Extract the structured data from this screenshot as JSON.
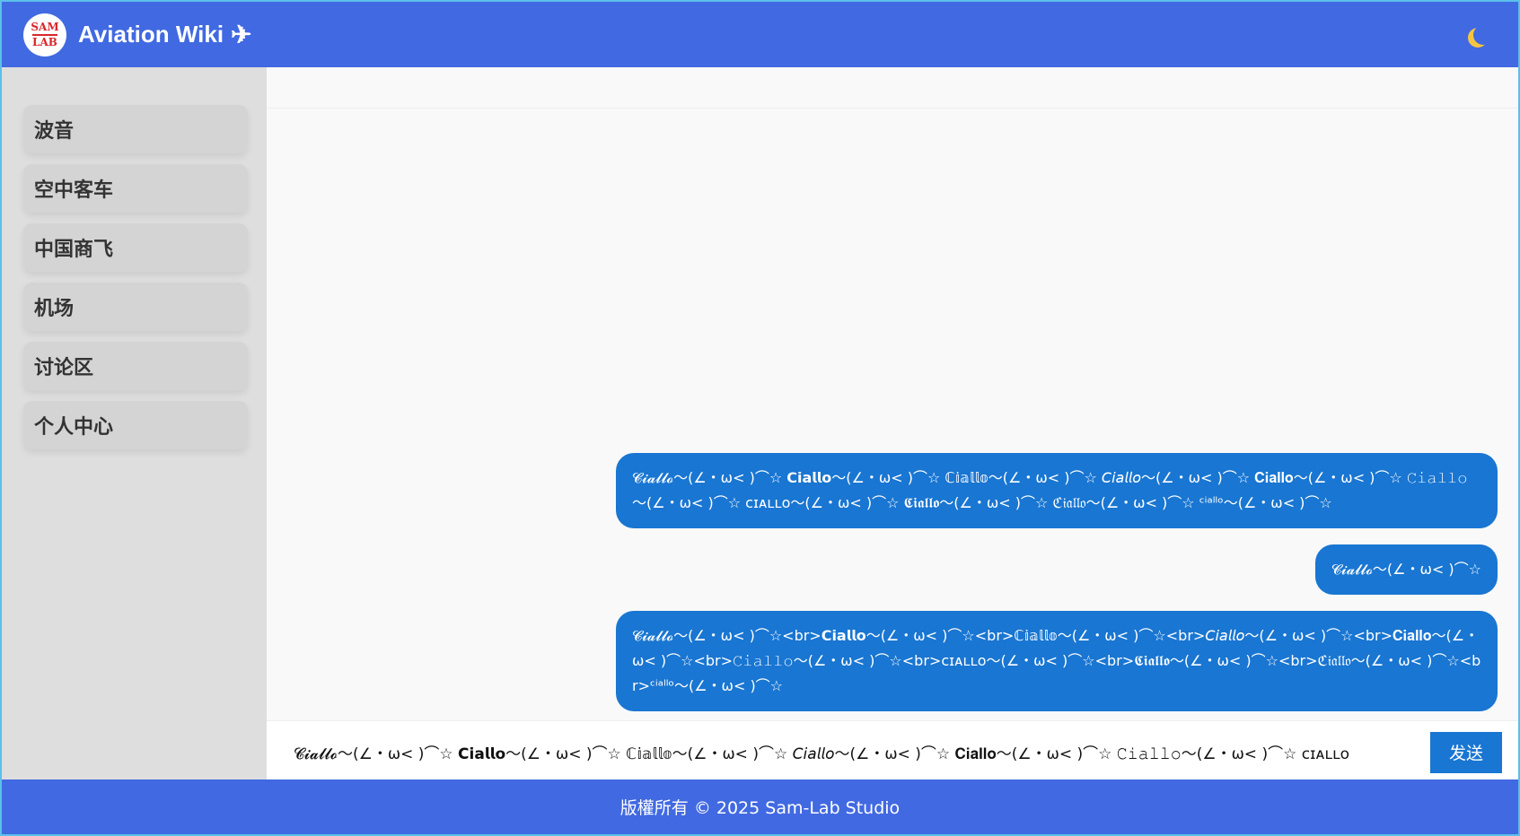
{
  "header": {
    "logo_top": "SAM",
    "logo_bottom": "LAB",
    "title": "Aviation Wiki",
    "plane_icon": "✈",
    "theme_icon": "moon-icon"
  },
  "sidebar": {
    "items": [
      {
        "label": "波音"
      },
      {
        "label": "空中客车"
      },
      {
        "label": "中国商飞"
      },
      {
        "label": "机场"
      },
      {
        "label": "讨论区"
      },
      {
        "label": "个人中心"
      }
    ]
  },
  "chat": {
    "messages": [
      {
        "text": "𝓒𝓲𝓪𝓵𝓵𝓸～(∠・ω< )⌒☆ 𝗖𝗶𝗮𝗹𝗹𝗼～(∠・ω< )⌒☆ ℂ𝕚𝕒𝕝𝕝𝕠～(∠・ω< )⌒☆ 𝘊𝘪𝘢𝘭𝘭𝘰～(∠・ω< )⌒☆ 𝐂𝐢𝐚𝐥𝐥𝐨～(∠・ω< )⌒☆ 𝙲𝚒𝚊𝚕𝚕𝚘～(∠・ω< )⌒☆ ᴄɪᴀʟʟᴏ～(∠・ω< )⌒☆ 𝕮𝖎𝖆𝖑𝖑𝖔～(∠・ω< )⌒☆ ℭ𝔦𝔞𝔩𝔩𝔬～(∠・ω< )⌒☆ ᶜⁱᵃˡˡᵒ～(∠・ω< )⌒☆"
      },
      {
        "text": "𝓒𝓲𝓪𝓵𝓵𝓸～(∠・ω< )⌒☆"
      },
      {
        "text": "𝓒𝓲𝓪𝓵𝓵𝓸～(∠・ω< )⌒☆<br>𝗖𝗶𝗮𝗹𝗹𝗼～(∠・ω< )⌒☆<br>ℂ𝕚𝕒𝕝𝕝𝕠～(∠・ω< )⌒☆<br>𝘊𝘪𝘢𝘭𝘭𝘰～(∠・ω< )⌒☆<br>𝐂𝐢𝐚𝐥𝐥𝐨～(∠・ω< )⌒☆<br>𝙲𝚒𝚊𝚕𝚕𝚘～(∠・ω< )⌒☆<br>ᴄɪᴀʟʟᴏ～(∠・ω< )⌒☆<br>𝕮𝖎𝖆𝖑𝖑𝖔～(∠・ω< )⌒☆<br>ℭ𝔦𝔞𝔩𝔩𝔬～(∠・ω< )⌒☆<br>ᶜⁱᵃˡˡᵒ～(∠・ω< )⌒☆"
      }
    ],
    "input_value": "𝓒𝓲𝓪𝓵𝓵𝓸～(∠・ω< )⌒☆ 𝗖𝗶𝗮𝗹𝗹𝗼～(∠・ω< )⌒☆ ℂ𝕚𝕒𝕝𝕝𝕠～(∠・ω< )⌒☆ 𝘊𝘪𝘢𝘭𝘭𝘰～(∠・ω< )⌒☆ 𝐂𝐢𝐚𝐥𝐥𝐨～(∠・ω< )⌒☆ 𝙲𝚒𝚊𝚕𝚕𝚘～(∠・ω< )⌒☆ ᴄɪᴀʟʟᴏ",
    "send_label": "发送"
  },
  "footer": {
    "text": "版權所有 © 2025 Sam-Lab Studio"
  },
  "colors": {
    "header_bg": "#4169e1",
    "bubble_bg": "#1976d2",
    "sidebar_bg": "#dedede"
  }
}
